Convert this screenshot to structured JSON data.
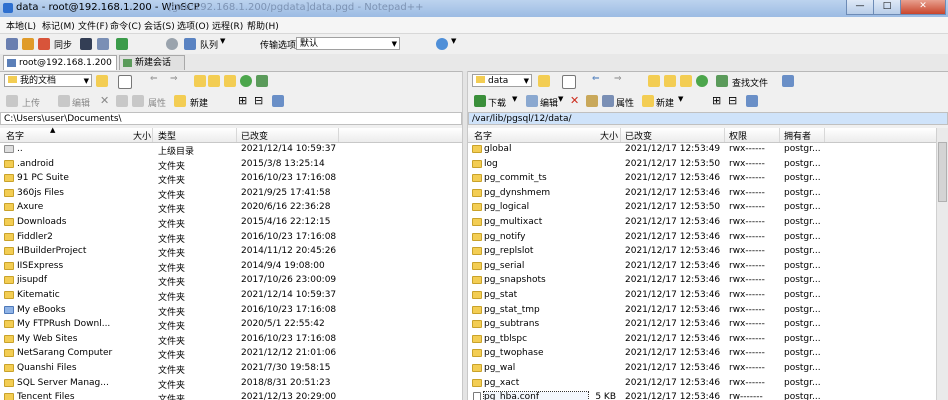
{
  "window": {
    "title": "data - root@192.168.1.200 - WinSCP",
    "ghost_title": "[gxb:192.168.1.200/pgdata]data.pgd - Notepad++",
    "min": "—",
    "max": "□",
    "close": "✕"
  },
  "menu": [
    "本地(L)",
    "标记(M)",
    "文件(F)",
    "命令(C)",
    "会话(S)",
    "选项(O)",
    "远程(R)",
    "帮助(H)"
  ],
  "toolbar": {
    "sync": "同步",
    "queue": "队列",
    "transfer_settings_label": "传输选项",
    "transfer_settings_value": "默认"
  },
  "tabs": {
    "session": "root@192.168.1.200",
    "new_session": "新建会话"
  },
  "left": {
    "location": "我的文档",
    "upload": "上传",
    "edit": "编辑",
    "properties": "属性",
    "new": "新建",
    "path": "C:\\Users\\user\\Documents\\",
    "columns": {
      "name": "名字",
      "size": "大小",
      "type": "类型",
      "modified": "已改变"
    },
    "rows": [
      {
        "name": "..",
        "size": "",
        "type": "上级目录",
        "modified": "2021/12/14  10:59:37",
        "icon": "up"
      },
      {
        "name": ".android",
        "size": "",
        "type": "文件夹",
        "modified": "2015/3/8  13:25:14",
        "icon": "folder"
      },
      {
        "name": "91 PC Suite",
        "size": "",
        "type": "文件夹",
        "modified": "2016/10/23  17:16:08",
        "icon": "folder"
      },
      {
        "name": "360js Files",
        "size": "",
        "type": "文件夹",
        "modified": "2021/9/25  17:41:58",
        "icon": "folder"
      },
      {
        "name": "Axure",
        "size": "",
        "type": "文件夹",
        "modified": "2020/6/16  22:36:28",
        "icon": "folder"
      },
      {
        "name": "Downloads",
        "size": "",
        "type": "文件夹",
        "modified": "2015/4/16  22:12:15",
        "icon": "folder"
      },
      {
        "name": "Fiddler2",
        "size": "",
        "type": "文件夹",
        "modified": "2016/10/23  17:16:08",
        "icon": "folder"
      },
      {
        "name": "HBuilderProject",
        "size": "",
        "type": "文件夹",
        "modified": "2014/11/12  20:45:26",
        "icon": "folder"
      },
      {
        "name": "IISExpress",
        "size": "",
        "type": "文件夹",
        "modified": "2014/9/4  19:08:00",
        "icon": "folder"
      },
      {
        "name": "jisupdf",
        "size": "",
        "type": "文件夹",
        "modified": "2017/10/26  23:00:09",
        "icon": "folder"
      },
      {
        "name": "Kitematic",
        "size": "",
        "type": "文件夹",
        "modified": "2021/12/14  10:59:37",
        "icon": "folder"
      },
      {
        "name": "My eBooks",
        "size": "",
        "type": "文件夹",
        "modified": "2016/10/23  17:16:08",
        "icon": "special"
      },
      {
        "name": "My FTPRush Downl...",
        "size": "",
        "type": "文件夹",
        "modified": "2020/5/1  22:55:42",
        "icon": "folder"
      },
      {
        "name": "My Web Sites",
        "size": "",
        "type": "文件夹",
        "modified": "2016/10/23  17:16:08",
        "icon": "folder"
      },
      {
        "name": "NetSarang Computer",
        "size": "",
        "type": "文件夹",
        "modified": "2021/12/12  21:01:06",
        "icon": "folder"
      },
      {
        "name": "Quanshi Files",
        "size": "",
        "type": "文件夹",
        "modified": "2021/7/30  19:58:15",
        "icon": "folder"
      },
      {
        "name": "SQL Server Manag...",
        "size": "",
        "type": "文件夹",
        "modified": "2018/8/31  20:51:23",
        "icon": "folder"
      },
      {
        "name": "Tencent Files",
        "size": "",
        "type": "文件夹",
        "modified": "2021/12/13  20:29:00",
        "icon": "folder"
      }
    ]
  },
  "right": {
    "location": "data",
    "download": "下载",
    "edit": "编辑",
    "properties": "属性",
    "new": "新建",
    "find": "查找文件",
    "path": "/var/lib/pgsql/12/data/",
    "columns": {
      "name": "名字",
      "size": "大小",
      "modified": "已改变",
      "rights": "权限",
      "owner": "拥有者"
    },
    "rows": [
      {
        "name": "global",
        "size": "",
        "modified": "2021/12/17  12:53:49",
        "rights": "rwx------",
        "owner": "postgr...",
        "icon": "folder"
      },
      {
        "name": "log",
        "size": "",
        "modified": "2021/12/17  12:53:50",
        "rights": "rwx------",
        "owner": "postgr...",
        "icon": "folder"
      },
      {
        "name": "pg_commit_ts",
        "size": "",
        "modified": "2021/12/17  12:53:46",
        "rights": "rwx------",
        "owner": "postgr...",
        "icon": "folder"
      },
      {
        "name": "pg_dynshmem",
        "size": "",
        "modified": "2021/12/17  12:53:46",
        "rights": "rwx------",
        "owner": "postgr...",
        "icon": "folder"
      },
      {
        "name": "pg_logical",
        "size": "",
        "modified": "2021/12/17  12:53:50",
        "rights": "rwx------",
        "owner": "postgr...",
        "icon": "folder"
      },
      {
        "name": "pg_multixact",
        "size": "",
        "modified": "2021/12/17  12:53:46",
        "rights": "rwx------",
        "owner": "postgr...",
        "icon": "folder"
      },
      {
        "name": "pg_notify",
        "size": "",
        "modified": "2021/12/17  12:53:46",
        "rights": "rwx------",
        "owner": "postgr...",
        "icon": "folder"
      },
      {
        "name": "pg_replslot",
        "size": "",
        "modified": "2021/12/17  12:53:46",
        "rights": "rwx------",
        "owner": "postgr...",
        "icon": "folder"
      },
      {
        "name": "pg_serial",
        "size": "",
        "modified": "2021/12/17  12:53:46",
        "rights": "rwx------",
        "owner": "postgr...",
        "icon": "folder"
      },
      {
        "name": "pg_snapshots",
        "size": "",
        "modified": "2021/12/17  12:53:46",
        "rights": "rwx------",
        "owner": "postgr...",
        "icon": "folder"
      },
      {
        "name": "pg_stat",
        "size": "",
        "modified": "2021/12/17  12:53:46",
        "rights": "rwx------",
        "owner": "postgr...",
        "icon": "folder"
      },
      {
        "name": "pg_stat_tmp",
        "size": "",
        "modified": "2021/12/17  12:53:46",
        "rights": "rwx------",
        "owner": "postgr...",
        "icon": "folder"
      },
      {
        "name": "pg_subtrans",
        "size": "",
        "modified": "2021/12/17  12:53:46",
        "rights": "rwx------",
        "owner": "postgr...",
        "icon": "folder"
      },
      {
        "name": "pg_tblspc",
        "size": "",
        "modified": "2021/12/17  12:53:46",
        "rights": "rwx------",
        "owner": "postgr...",
        "icon": "folder"
      },
      {
        "name": "pg_twophase",
        "size": "",
        "modified": "2021/12/17  12:53:46",
        "rights": "rwx------",
        "owner": "postgr...",
        "icon": "folder"
      },
      {
        "name": "pg_wal",
        "size": "",
        "modified": "2021/12/17  12:53:46",
        "rights": "rwx------",
        "owner": "postgr...",
        "icon": "folder"
      },
      {
        "name": "pg_xact",
        "size": "",
        "modified": "2021/12/17  12:53:46",
        "rights": "rwx------",
        "owner": "postgr...",
        "icon": "folder"
      },
      {
        "name": "pg_hba.conf",
        "size": "5 KB",
        "modified": "2021/12/17  12:53:46",
        "rights": "rw-------",
        "owner": "postgr...",
        "icon": "file"
      }
    ]
  },
  "colors": {
    "folder": "#f3cd53",
    "titlebar": "#9cbbe3",
    "active_path": "#cfe3fa"
  }
}
